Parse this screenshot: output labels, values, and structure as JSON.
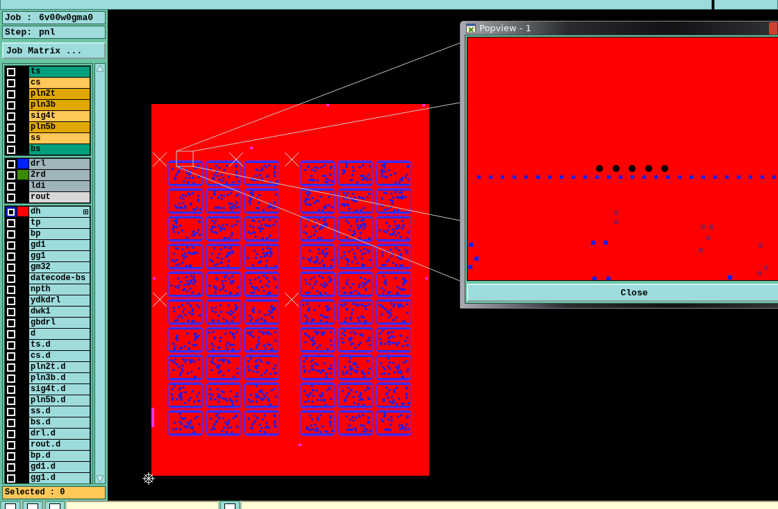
{
  "job": {
    "label": "Job :",
    "name": "6v00w0gma0"
  },
  "step": {
    "label": "Step:",
    "name": "pnl"
  },
  "job_matrix_button": "Job Matrix ...",
  "layer_groups": [
    {
      "rows": [
        {
          "name": "ts",
          "color": "#00a07c",
          "checked": false,
          "selected": false,
          "expandable": false
        },
        {
          "name": "cs",
          "color": "#ffc858",
          "checked": false,
          "selected": false,
          "expandable": false
        },
        {
          "name": "pln2t",
          "color": "#e0a800",
          "checked": false,
          "selected": false,
          "expandable": false
        },
        {
          "name": "pln3b",
          "color": "#e0a800",
          "checked": false,
          "selected": false,
          "expandable": false
        },
        {
          "name": "sig4t",
          "color": "#ffc858",
          "checked": false,
          "selected": false,
          "expandable": false
        },
        {
          "name": "pln5b",
          "color": "#e0a800",
          "checked": false,
          "selected": false,
          "expandable": false
        },
        {
          "name": "ss",
          "color": "#ffc858",
          "checked": false,
          "selected": false,
          "expandable": false
        },
        {
          "name": "bs",
          "color": "#00a07c",
          "checked": false,
          "selected": false,
          "expandable": false
        }
      ]
    },
    {
      "rows": [
        {
          "name": "drl",
          "color": "#a0b4bc",
          "swatch": {
            "color": "#0022ff"
          },
          "checked": false,
          "selected": false,
          "expandable": false
        },
        {
          "name": "2rd",
          "color": "#a0b4bc",
          "swatch": {
            "color": "#3a8a00"
          },
          "checked": false,
          "selected": false,
          "expandable": false
        },
        {
          "name": "ldi",
          "color": "#a0b4bc",
          "checked": false,
          "selected": false,
          "expandable": false
        },
        {
          "name": "rout",
          "color": "#d8d8d8",
          "checked": false,
          "selected": false,
          "expandable": false
        }
      ]
    },
    {
      "rows": [
        {
          "name": "dh",
          "color": "#9edcdc",
          "swatch": {
            "color": "#ff0000"
          },
          "checked": false,
          "selected": true,
          "expandable": true
        },
        {
          "name": "tp",
          "color": "#9edcdc",
          "checked": false,
          "selected": false,
          "expandable": false
        },
        {
          "name": "bp",
          "color": "#9edcdc",
          "checked": false,
          "selected": false,
          "expandable": false
        },
        {
          "name": "gd1",
          "color": "#9edcdc",
          "checked": false,
          "selected": false,
          "expandable": false
        },
        {
          "name": "gg1",
          "color": "#9edcdc",
          "checked": false,
          "selected": false,
          "expandable": false
        },
        {
          "name": "gm32",
          "color": "#9edcdc",
          "checked": false,
          "selected": false,
          "expandable": false
        },
        {
          "name": "datecode-bs",
          "color": "#9edcdc",
          "checked": false,
          "selected": false,
          "expandable": false
        },
        {
          "name": "npth",
          "color": "#9edcdc",
          "checked": false,
          "selected": false,
          "expandable": false
        },
        {
          "name": "ydkdrl",
          "color": "#9edcdc",
          "checked": false,
          "selected": false,
          "expandable": false
        },
        {
          "name": "dwk1",
          "color": "#9edcdc",
          "checked": false,
          "selected": false,
          "expandable": false
        },
        {
          "name": "gbdrl",
          "color": "#9edcdc",
          "checked": false,
          "selected": false,
          "expandable": false
        },
        {
          "name": "d",
          "color": "#9edcdc",
          "checked": false,
          "selected": false,
          "expandable": false
        },
        {
          "name": "ts.d",
          "color": "#9edcdc",
          "checked": false,
          "selected": false,
          "expandable": false
        },
        {
          "name": "cs.d",
          "color": "#9edcdc",
          "checked": false,
          "selected": false,
          "expandable": false
        },
        {
          "name": "pln2t.d",
          "color": "#9edcdc",
          "checked": false,
          "selected": false,
          "expandable": false
        },
        {
          "name": "pln3b.d",
          "color": "#9edcdc",
          "checked": false,
          "selected": false,
          "expandable": false
        },
        {
          "name": "sig4t.d",
          "color": "#9edcdc",
          "checked": false,
          "selected": false,
          "expandable": false
        },
        {
          "name": "pln5b.d",
          "color": "#9edcdc",
          "checked": false,
          "selected": false,
          "expandable": false
        },
        {
          "name": "ss.d",
          "color": "#9edcdc",
          "checked": false,
          "selected": false,
          "expandable": false
        },
        {
          "name": "bs.d",
          "color": "#9edcdc",
          "checked": false,
          "selected": false,
          "expandable": false
        },
        {
          "name": "drl.d",
          "color": "#9edcdc",
          "checked": false,
          "selected": false,
          "expandable": false
        },
        {
          "name": "rout.d",
          "color": "#9edcdc",
          "checked": false,
          "selected": false,
          "expandable": false
        },
        {
          "name": "bp.d",
          "color": "#9edcdc",
          "checked": false,
          "selected": false,
          "expandable": false
        },
        {
          "name": "gd1.d",
          "color": "#9edcdc",
          "checked": false,
          "selected": false,
          "expandable": false
        },
        {
          "name": "gg1.d",
          "color": "#9edcdc",
          "checked": false,
          "selected": false,
          "expandable": false
        }
      ]
    }
  ],
  "selected_count": "Selected : 0",
  "popview": {
    "title": "Popview - 1",
    "close_button": "Close"
  }
}
